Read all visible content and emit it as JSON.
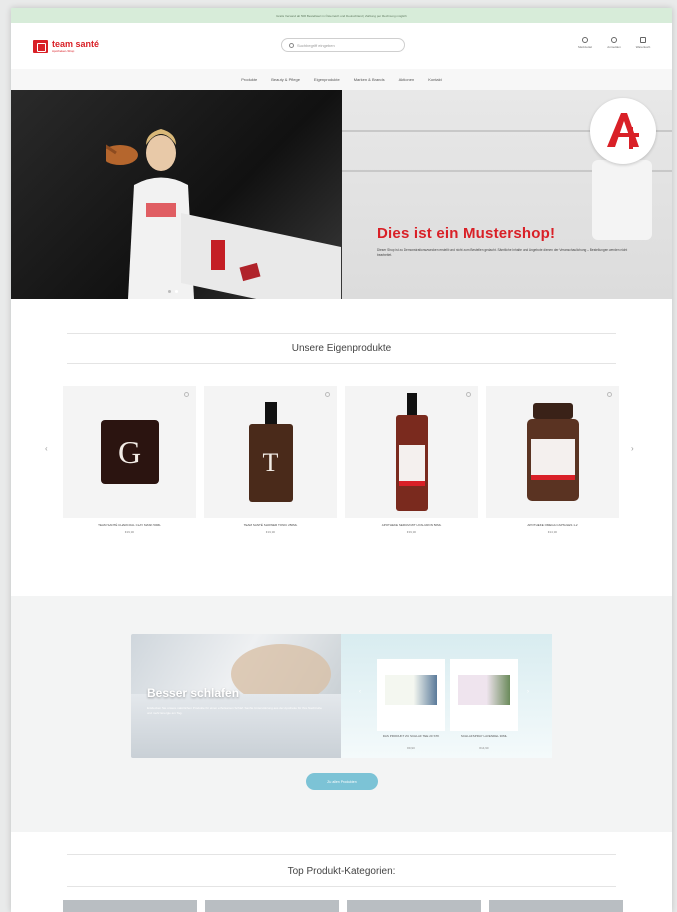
{
  "topbar": {
    "text": "Gratis Versand ab 50€ Bestellwert in Österreich und Deutschland | Zahlung per Rechnung möglich"
  },
  "header": {
    "logo_name": "team santé",
    "logo_sub": "Apotheken-Shop",
    "search_placeholder": "Suchbegriff eingeben",
    "icons": [
      {
        "name": "heart-icon",
        "label": "Merkzettel"
      },
      {
        "name": "user-icon",
        "label": "Anmelden"
      },
      {
        "name": "cart-icon",
        "label": "Warenkorb"
      }
    ]
  },
  "nav": {
    "items": [
      "Produkte",
      "Beauty & Pflege",
      "Eigenprodukte",
      "Marken & Brands",
      "Aktionen",
      "Kontakt"
    ]
  },
  "hero": {
    "title": "Dies ist ein Mustershop!",
    "text": "Dieser Shop ist zu Demonstrationszwecken erstellt und nicht zum Bestellen gedacht. Sämtliche Inhalte und Angebote dienen der Veranschaulichung – Bestellungen werden nicht bearbeitet."
  },
  "eigenprodukte": {
    "title": "Unsere Eigenprodukte",
    "products": [
      {
        "name": "TEAM SANTÉ CHARCOAL CLAY MASK 50ML",
        "price": "€29,90",
        "letter": "G"
      },
      {
        "name": "TEAM SANTÉ SHOWER TONIC 250ML",
        "price": "€19,90",
        "letter": "T"
      },
      {
        "name": "APOTHEKE SERUM MIT HYALURON 50ML",
        "price": "€39,90",
        "letter": ""
      },
      {
        "name": "APOTHEKE OMEGA CAPSULES 1-2",
        "price": "€24,90",
        "letter": ""
      }
    ]
  },
  "promo": {
    "title": "Besser schlafen",
    "text": "Entdecken Sie unsere natürlichen Produkte für einen erholsamen Schlaf. Sanfte Unterstützung aus der Apotheke für Ihre Nachtruhe und mehr Energie am Tag.",
    "products": [
      {
        "name": "DAS PRODUKT ZU SCHLAF TEE 20 STK",
        "price": "€9,90"
      },
      {
        "name": "SCHLAFSPRAY LAVENDEL 30ML",
        "price": "€14,90"
      }
    ],
    "cta": "Zu allen Produkten"
  },
  "categories": {
    "title": "Top Produkt-Kategorien:"
  }
}
